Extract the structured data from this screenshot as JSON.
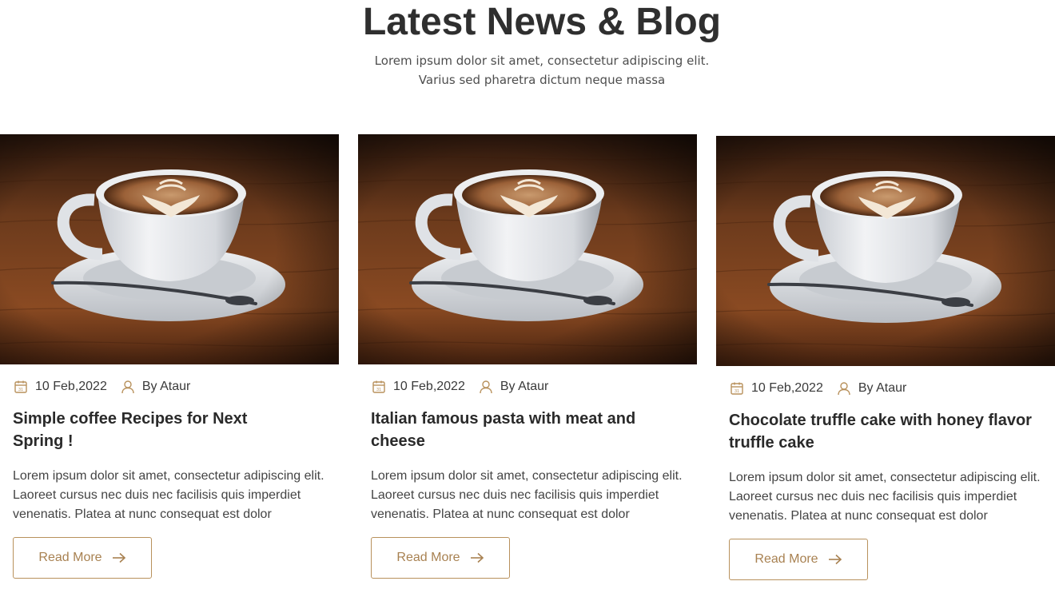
{
  "header": {
    "title": "Latest News & Blog",
    "subtitle_line1": "Lorem ipsum dolor sit amet, consectetur adipiscing elit.",
    "subtitle_line2": "Varius sed pharetra dictum neque massa"
  },
  "colors": {
    "accent": "#b8915c",
    "text_dark": "#2f2f2f",
    "wood": "#6b3a1c"
  },
  "posts": [
    {
      "image_icon": "coffee-latte-image",
      "date": "10 Feb,2022",
      "author": "By Ataur",
      "title": "Simple coffee Recipes for Next Spring !",
      "excerpt": "Lorem ipsum dolor sit amet, consectetur adipiscing elit. Laoreet cursus nec duis nec facilisis quis imperdiet venenatis. Platea at nunc consequat est dolor",
      "button_label": "Read More"
    },
    {
      "image_icon": "coffee-latte-image",
      "date": "10 Feb,2022",
      "author": "By Ataur",
      "title": "Italian famous pasta with meat and cheese",
      "excerpt": "Lorem ipsum dolor sit amet, consectetur adipiscing elit. Laoreet cursus nec duis nec facilisis quis imperdiet venenatis. Platea at nunc consequat est dolor",
      "button_label": "Read More"
    },
    {
      "image_icon": "coffee-latte-image",
      "date": "10 Feb,2022",
      "author": "By Ataur",
      "title": "Chocolate truffle cake with honey flavor truffle cake",
      "excerpt": "Lorem ipsum dolor sit amet, consectetur adipiscing elit. Laoreet cursus nec duis nec facilisis quis imperdiet venenatis. Platea at nunc consequat est dolor",
      "button_label": "Read More"
    }
  ]
}
